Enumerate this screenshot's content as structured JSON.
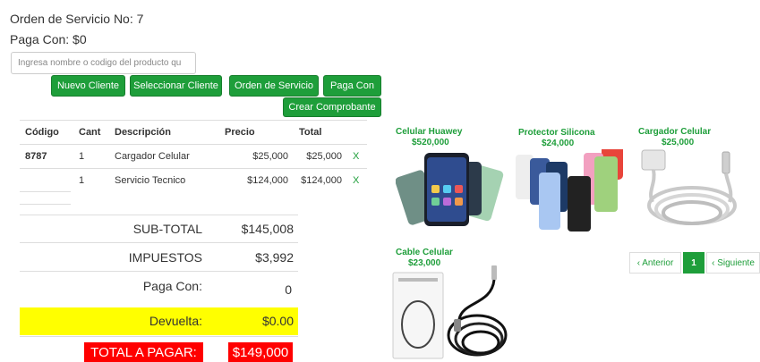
{
  "order": {
    "title": "Orden de Servicio No: 7",
    "paga_con_header": "Paga Con: $0"
  },
  "search": {
    "placeholder": "Ingresa nombre o codigo del producto qu"
  },
  "buttons": {
    "nuevo_cliente": "Nuevo Cliente",
    "seleccionar_cliente": "Seleccionar Cliente",
    "orden_servicio": "Orden de Servicio",
    "paga_con": "Paga Con",
    "crear_comprobante": "Crear Comprobante"
  },
  "table": {
    "headers": [
      "Código",
      "Cant",
      "Descripción",
      "Precio",
      "Total"
    ],
    "rows": [
      {
        "codigo": "8787",
        "cant": "1",
        "descripcion": "Cargador Celular",
        "precio": "$25,000",
        "total": "$25,000",
        "delete": "X"
      },
      {
        "codigo": "",
        "cant": "1",
        "descripcion": "Servicio Tecnico",
        "precio": "$124,000",
        "total": "$124,000",
        "delete": "X"
      }
    ]
  },
  "summary": {
    "subtotal_label": "SUB-TOTAL",
    "subtotal_value": "$145,008",
    "impuestos_label": "IMPUESTOS",
    "impuestos_value": "$3,992",
    "paga_con_label": "Paga Con:",
    "paga_con_value": "0",
    "devuelta_label": "Devuelta:",
    "devuelta_value": "$0.00",
    "total_label": "TOTAL A PAGAR:",
    "total_value": "$149,000"
  },
  "products": [
    {
      "name": "Celular Huawey",
      "price": "$520,000",
      "icon": "phone-image"
    },
    {
      "name": "Protector Silicona",
      "price": "$24,000",
      "icon": "case-image"
    },
    {
      "name": "Cargador Celular",
      "price": "$25,000",
      "icon": "charger-image"
    },
    {
      "name": "Cable Celular",
      "price": "$23,000",
      "icon": "cable-image"
    }
  ],
  "pagination": {
    "prev": "‹ Anterior",
    "page": "1",
    "next": "‹ Siguiente"
  },
  "colors": {
    "accent": "#1e9e3a",
    "yellow": "#ffff00",
    "red": "#ff0000"
  }
}
